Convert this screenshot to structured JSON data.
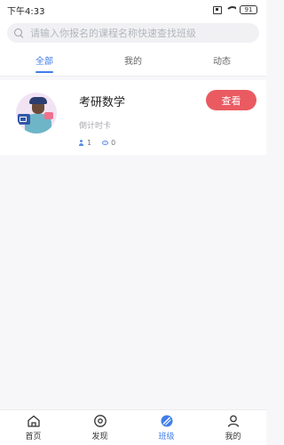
{
  "status": {
    "time": "下午4:33",
    "battery": "91"
  },
  "search": {
    "placeholder": "请输入你报名的课程名称快速查找班级"
  },
  "tabs": [
    {
      "label": "全部",
      "active": true
    },
    {
      "label": "我的",
      "active": false
    },
    {
      "label": "动态",
      "active": false
    }
  ],
  "course": {
    "title": "考研数学",
    "subtitle": "倒计时卡",
    "button_label": "查看",
    "members": "1",
    "views": "0"
  },
  "nav": [
    {
      "label": "首页",
      "icon": "home-icon"
    },
    {
      "label": "发现",
      "icon": "discover-icon"
    },
    {
      "label": "班级",
      "icon": "class-icon",
      "active": true
    },
    {
      "label": "我的",
      "icon": "profile-icon"
    }
  ],
  "colors": {
    "accent": "#3f7dea",
    "button": "#ea5a61"
  }
}
